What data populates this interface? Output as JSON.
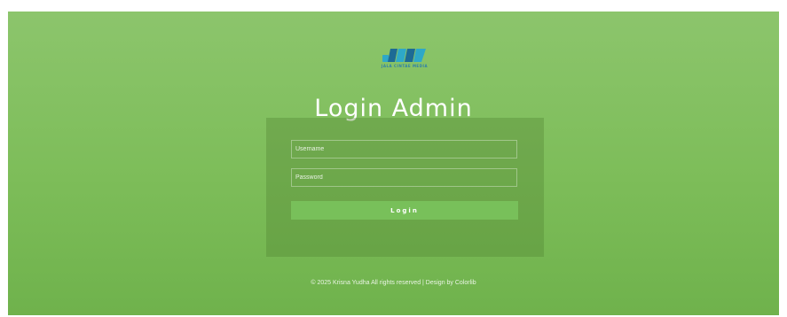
{
  "logo": {
    "mark_icon": "jimmy-logo-icon",
    "tagline": "JALA CINTAE MEDIA",
    "colors": {
      "mark": "#2ea8c8",
      "accent": "#1d6b95"
    }
  },
  "header": {
    "title": "Login Admin"
  },
  "form": {
    "username_placeholder": "Username",
    "password_placeholder": "Password",
    "login_label": "Login"
  },
  "footer": {
    "text": "© 2025 Krisna Yudha All rights reserved | Design by Colorlib"
  },
  "theme": {
    "background": "#7dbd59",
    "button": "#78c05a",
    "text": "#ffffff"
  }
}
